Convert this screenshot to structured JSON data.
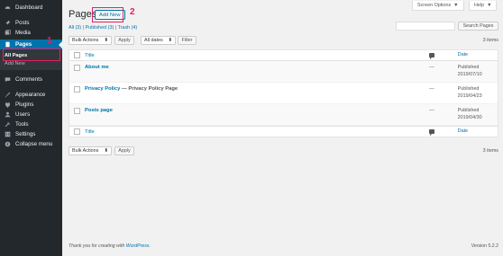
{
  "sidebar": {
    "items": [
      {
        "label": "Dashboard",
        "icon": "dashboard-icon"
      },
      {
        "label": "Posts",
        "icon": "pin-icon"
      },
      {
        "label": "Media",
        "icon": "media-icon"
      },
      {
        "label": "Pages",
        "icon": "pages-icon"
      },
      {
        "label": "Comments",
        "icon": "comment-icon"
      },
      {
        "label": "Appearance",
        "icon": "brush-icon"
      },
      {
        "label": "Plugins",
        "icon": "plug-icon"
      },
      {
        "label": "Users",
        "icon": "user-icon"
      },
      {
        "label": "Tools",
        "icon": "wrench-icon"
      },
      {
        "label": "Settings",
        "icon": "settings-icon"
      },
      {
        "label": "Collapse menu",
        "icon": "collapse-icon"
      }
    ],
    "submenu": [
      "All Pages",
      "Add New"
    ]
  },
  "annotations": {
    "one": "1",
    "two": "2",
    "color": "#e91e63"
  },
  "header": {
    "title": "Pages",
    "add_new": "Add New",
    "screen_options": "Screen Options",
    "help": "Help"
  },
  "filters": {
    "all": "All (3)",
    "published": "Published (3)",
    "trash": "Trash (4)",
    "sep": "|"
  },
  "search": {
    "button": "Search Pages"
  },
  "tablenav": {
    "bulk_actions": "Bulk Actions",
    "apply": "Apply",
    "all_dates": "All dates",
    "filter": "Filter",
    "count": "3 items"
  },
  "table": {
    "col_title": "Title",
    "col_date": "Date",
    "rows": [
      {
        "title": "About me",
        "state": "",
        "comments": "—",
        "status": "Published",
        "date": "2019/07/10"
      },
      {
        "title": "Privacy Policy",
        "state": " — Privacy Policy Page",
        "comments": "—",
        "status": "Published",
        "date": "2019/04/23"
      },
      {
        "title": "Posts page",
        "state": "",
        "comments": "—",
        "status": "Published",
        "date": "2019/04/30"
      }
    ]
  },
  "footer": {
    "thanks_prefix": "Thank you for creating with ",
    "thanks_link": "WordPress",
    "thanks_suffix": ".",
    "version": "Version 5.2.2"
  },
  "colors": {
    "accent": "#0073aa",
    "sidebar": "#23282d",
    "highlight": "#e91e63"
  }
}
